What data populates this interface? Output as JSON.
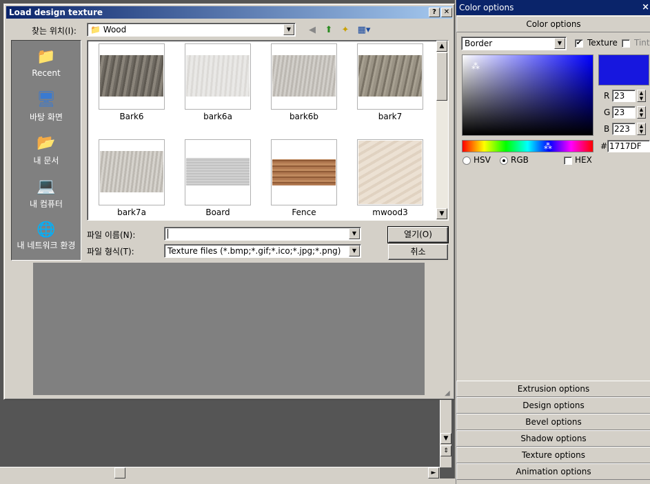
{
  "dialog": {
    "title": "Load design texture",
    "help_label": "?",
    "close_label": "✕",
    "look_in_label": "찾는 위치(I):",
    "look_in_value": "Wood",
    "filename_label": "파일 이름(N):",
    "filename_value": "",
    "filetype_label": "파일 형식(T):",
    "filetype_value": "Texture files (*.bmp;*.gif;*.ico;*.jpg;*.png)",
    "open_label": "열기(O)",
    "cancel_label": "취소"
  },
  "places": [
    {
      "label": "Recent",
      "icon": "folder-icon"
    },
    {
      "label": "바탕 화면",
      "icon": "desktop-icon"
    },
    {
      "label": "내 문서",
      "icon": "documents-icon"
    },
    {
      "label": "내 컴퓨터",
      "icon": "computer-icon"
    },
    {
      "label": "내 네트워크 환경",
      "icon": "network-icon"
    }
  ],
  "files": [
    {
      "name": "Bark6",
      "color": "#6f6a62"
    },
    {
      "name": "bark6a",
      "color": "#e6e4e2"
    },
    {
      "name": "bark6b",
      "color": "#c9c5c0"
    },
    {
      "name": "bark7",
      "color": "#8f887b"
    },
    {
      "name": "bark7a",
      "color": "#cfccc6"
    },
    {
      "name": "Board",
      "color": "#c6c6c6"
    },
    {
      "name": "Fence",
      "color": "#a7704a"
    },
    {
      "name": "mwood3",
      "color": "#e9dccd"
    }
  ],
  "panel": {
    "title": "Color options",
    "close_label": "×",
    "header": "Color options",
    "target_value": "Border",
    "texture_label": "Texture",
    "texture_checked": true,
    "tint_label": "Tint",
    "r_label": "R",
    "r_value": "23",
    "g_label": "G",
    "g_value": "23",
    "b_label": "B",
    "b_value": "223",
    "hex_prefix": "#",
    "hex_value": "1717DF",
    "swatch_color": "#1717df",
    "hsv_label": "HSV",
    "rgb_label": "RGB",
    "hex_label": "HEX",
    "mode_selected": "RGB",
    "sections": [
      "Extrusion options",
      "Design options",
      "Bevel options",
      "Shadow options",
      "Texture options",
      "Animation options"
    ]
  }
}
